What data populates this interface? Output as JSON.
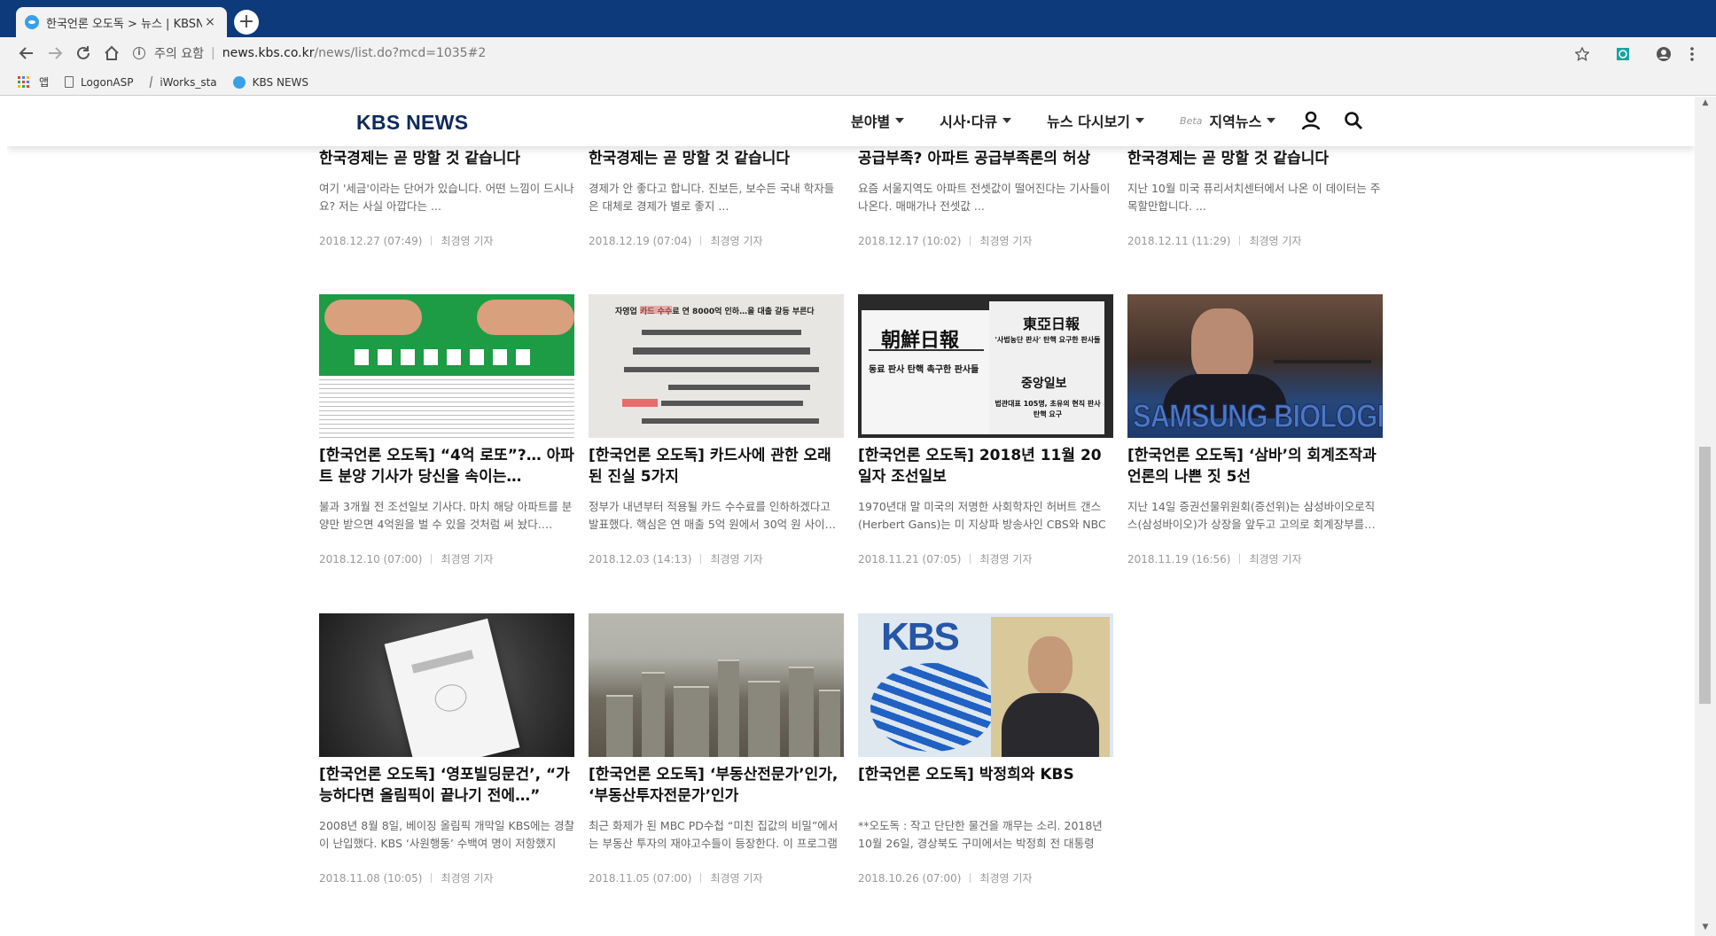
{
  "browser": {
    "tab_title": "한국언론 오도독 > 뉴스 | KBSN",
    "tab_close": "×",
    "new_tab": "+",
    "security_label": "주의 요함",
    "url_host": "news.kbs.co.kr",
    "url_path": "/news/list.do?mcd=1035#2",
    "bookmarks": [
      {
        "label": "앱",
        "icon": "apps-icon"
      },
      {
        "label": "LogonASP",
        "icon": "page-icon"
      },
      {
        "label": "iWorks_sta",
        "icon": "iworks-icon"
      },
      {
        "label": "KBS NEWS",
        "icon": "kbs-favicon"
      }
    ]
  },
  "site": {
    "logo": "KBS NEWS",
    "nav": [
      {
        "label": "분야별"
      },
      {
        "label": "시사·다큐"
      },
      {
        "label": "뉴스 다시보기"
      },
      {
        "label": "지역뉴스",
        "badge": "Beta"
      }
    ]
  },
  "reporter": "최경영 기자",
  "articles_top": [
    {
      "title": "한국경제는 곧 망할 것 같습니다",
      "desc": "여기 '세금'이라는 단어가 있습니다. 어떤 느낌이 드시나요? 저는 사실 아깝다는 ...",
      "date": "2018.12.27 (07:49)"
    },
    {
      "title": "한국경제는 곧 망할 것 같습니다",
      "desc": "경제가 안 좋다고 합니다. 진보든, 보수든 국내 학자들은 대체로 경제가 별로 좋지 ...",
      "date": "2018.12.19 (07:04)"
    },
    {
      "title": "공급부족? 아파트 공급부족론의 허상",
      "desc": "요즘 서울지역도 아파트 전셋값이 떨어진다는 기사들이 나온다. 매매가나 전셋값 ...",
      "date": "2018.12.17 (10:02)"
    },
    {
      "title": "한국경제는 곧 망할 것 같습니다",
      "desc": "지난 10월 미국 퓨리서치센터에서 나온 이 데이터는 주목할만합니다. ...",
      "date": "2018.12.11 (11:29)"
    }
  ],
  "articles_mid": [
    {
      "title": "[한국언론 오도독] “4억 로또”?… 아파트 분양 기사가 당신을 속이는…",
      "desc": "불과 3개월 전 조선일보 기사다. 마치 해당 아파트를 분양만 받으면 4억원을 벌 수 있을 것처럼 써 놨다.…",
      "date": "2018.12.10 (07:00)"
    },
    {
      "title": "[한국언론 오도독] 카드사에 관한 오래된 진실 5가지",
      "desc": "정부가 내년부터 적용될 카드 수수료를 인하하겠다고 발표했다. 핵심은 연 매출 5억 원에서 30억 원 사이…",
      "date": "2018.12.03 (14:13)"
    },
    {
      "title": "[한국언론 오도독] 2018년 11월 20일자 조선일보",
      "desc": "1970년대 말 미국의 저명한 사회학자인 허버트 갠스(Herbert Gans)는 미 지상파 방송사인 CBS와 NBC의…",
      "date": "2018.11.21 (07:05)"
    },
    {
      "title": "[한국언론 오도독] ‘삼바’의 회계조작과 언론의 나쁜 짓 5선",
      "desc": "지난 14일 증권선물위원회(증선위)는 삼성바이오로직스(삼성바이오)가 상장을 앞두고 고의로 회계장부를…",
      "date": "2018.11.19 (16:56)"
    }
  ],
  "articles_bottom": [
    {
      "title": "[한국언론 오도독] ‘영포빌딩문건’, “가능하다면 올림픽이 끝나기 전에…”",
      "desc": "2008년 8월 8일, 베이징 올림픽 개막일 KBS에는 경찰이 난입했다. KBS ‘사원행동’ 수백여 명이 저항했지만…",
      "date": "2018.11.08 (10:05)"
    },
    {
      "title": "[한국언론 오도독] ‘부동산전문가’인가, ‘부동산투자전문가’인가",
      "desc": "최근 화제가 된 MBC PD수첩 “미친 집값의 비밀”에서는 부동산 투자의 재야고수들이 등장한다. 이 프로그램에…",
      "date": "2018.11.05 (07:00)"
    },
    {
      "title": "[한국언론 오도독] 박정희와 KBS",
      "desc": "**오도독 : 작고 단단한 물건을 깨무는 소리. 2018년 10월 26일, 경상북도 구미에서는 박정희 전 대통령의…",
      "date": "2018.10.26 (07:00)"
    }
  ],
  "thumb_text": {
    "paper_headline": "자영업 카드 수수료 연 8000억 인하…올 대출 갈등 부른다",
    "news_mast_1": "朝鮮日報",
    "news_mast_2": "東亞日報",
    "news_mast_3": "중앙일보",
    "news_head_1": "동료 판사 탄핵 촉구한 판사들",
    "news_head_2": "'사법농단 판사' 탄핵 요구한 판사들",
    "news_head_3": "법관대표 105명, 초유의 현직 판사 탄핵 요구",
    "samsung_brand": "SAMSUNG BIOLOGICS",
    "kbs_logo": "KBS"
  }
}
